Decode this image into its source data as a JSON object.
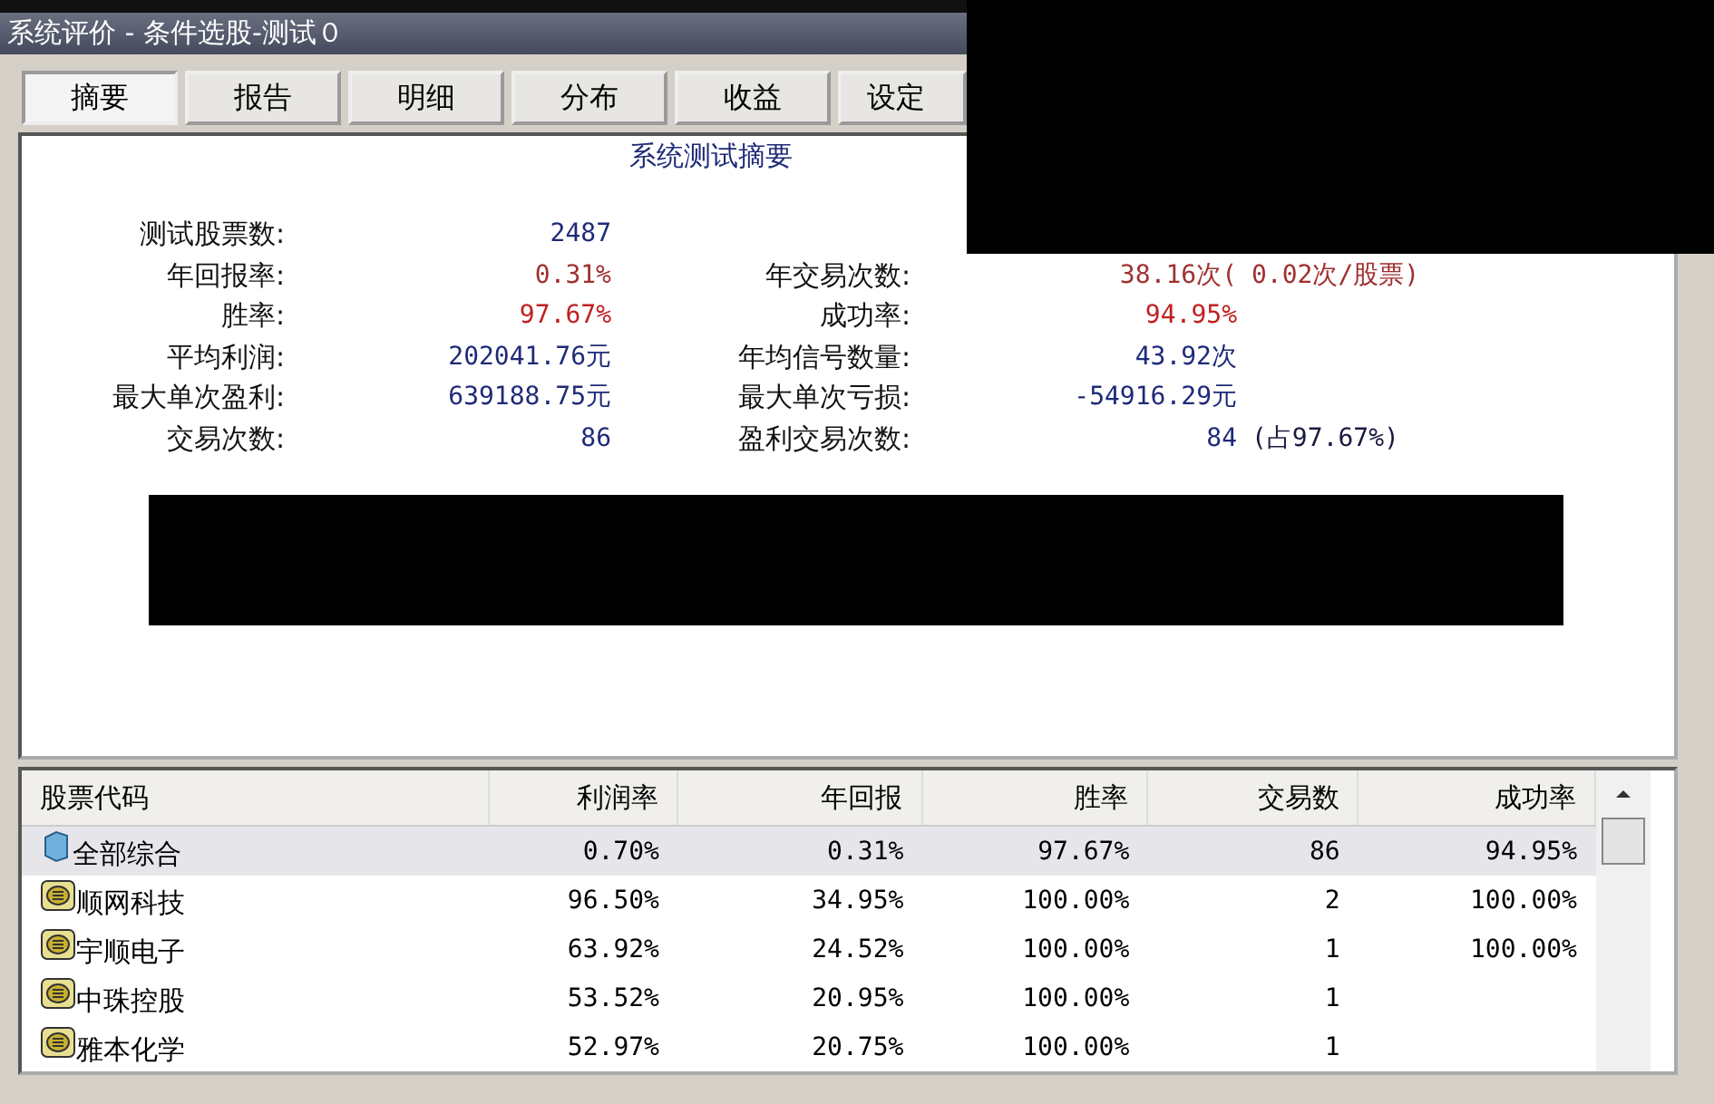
{
  "window": {
    "title": "系统评价 - 条件选股-测试０"
  },
  "tabs": [
    {
      "label": "摘要",
      "selected": true
    },
    {
      "label": "报告",
      "selected": false
    },
    {
      "label": "明细",
      "selected": false
    },
    {
      "label": "分布",
      "selected": false
    },
    {
      "label": "收益",
      "selected": false
    },
    {
      "label": "设定",
      "selected": false
    }
  ],
  "summary": {
    "title": "系统测试摘要",
    "rows": [
      {
        "stats": [
          {
            "label": "测试股票数:",
            "value": "2487",
            "color": "#1e2a78"
          }
        ]
      },
      {
        "stats": [
          {
            "label": "年回报率:",
            "value": "0.31%",
            "color": "#a03030"
          },
          {
            "label": "年交易次数:",
            "value": "38.16次(",
            "color": "#a03030"
          },
          {
            "value": "0.02次/股票)",
            "color": "#a03030"
          }
        ]
      },
      {
        "stats": [
          {
            "label": "胜率:",
            "value": "97.67%",
            "color": "#c02020"
          },
          {
            "label": "成功率:",
            "value": "94.95%",
            "color": "#c02020"
          }
        ]
      },
      {
        "stats": [
          {
            "label": "平均利润:",
            "value": "202041.76元",
            "color": "#1e2a78"
          },
          {
            "label": "年均信号数量:",
            "value": "43.92次",
            "color": "#1e2a78"
          }
        ]
      },
      {
        "stats": [
          {
            "label": "最大单次盈利:",
            "value": "639188.75元",
            "color": "#1e2a78"
          },
          {
            "label": "最大单次亏损:",
            "value": "-54916.29元",
            "color": "#1e2a78"
          }
        ]
      },
      {
        "stats": [
          {
            "label": "交易次数:",
            "value": "86",
            "color": "#1e2a78"
          },
          {
            "label": "盈利交易次数:",
            "value": "84",
            "color": "#1e2a78"
          },
          {
            "value": "(占97.67%)",
            "color": "#1a1a40"
          }
        ]
      }
    ]
  },
  "table": {
    "columns": [
      "股票代码",
      "利润率",
      "年回报",
      "胜率",
      "交易数",
      "成功率"
    ],
    "rows": [
      {
        "kind": "summary",
        "selected": true,
        "cells": [
          "全部综合",
          "0.70%",
          "0.31%",
          "97.67%",
          "86",
          "94.95%"
        ]
      },
      {
        "kind": "stock",
        "selected": false,
        "cells": [
          "顺网科技",
          "96.50%",
          "34.95%",
          "100.00%",
          "2",
          "100.00%"
        ]
      },
      {
        "kind": "stock",
        "selected": false,
        "cells": [
          "宇顺电子",
          "63.92%",
          "24.52%",
          "100.00%",
          "1",
          "100.00%"
        ]
      },
      {
        "kind": "stock",
        "selected": false,
        "cells": [
          "中珠控股",
          "53.52%",
          "20.95%",
          "100.00%",
          "1"
        ]
      },
      {
        "kind": "stock",
        "selected": false,
        "cells": [
          "雅本化学",
          "52.97%",
          "20.75%",
          "100.00%",
          "1"
        ]
      }
    ]
  }
}
